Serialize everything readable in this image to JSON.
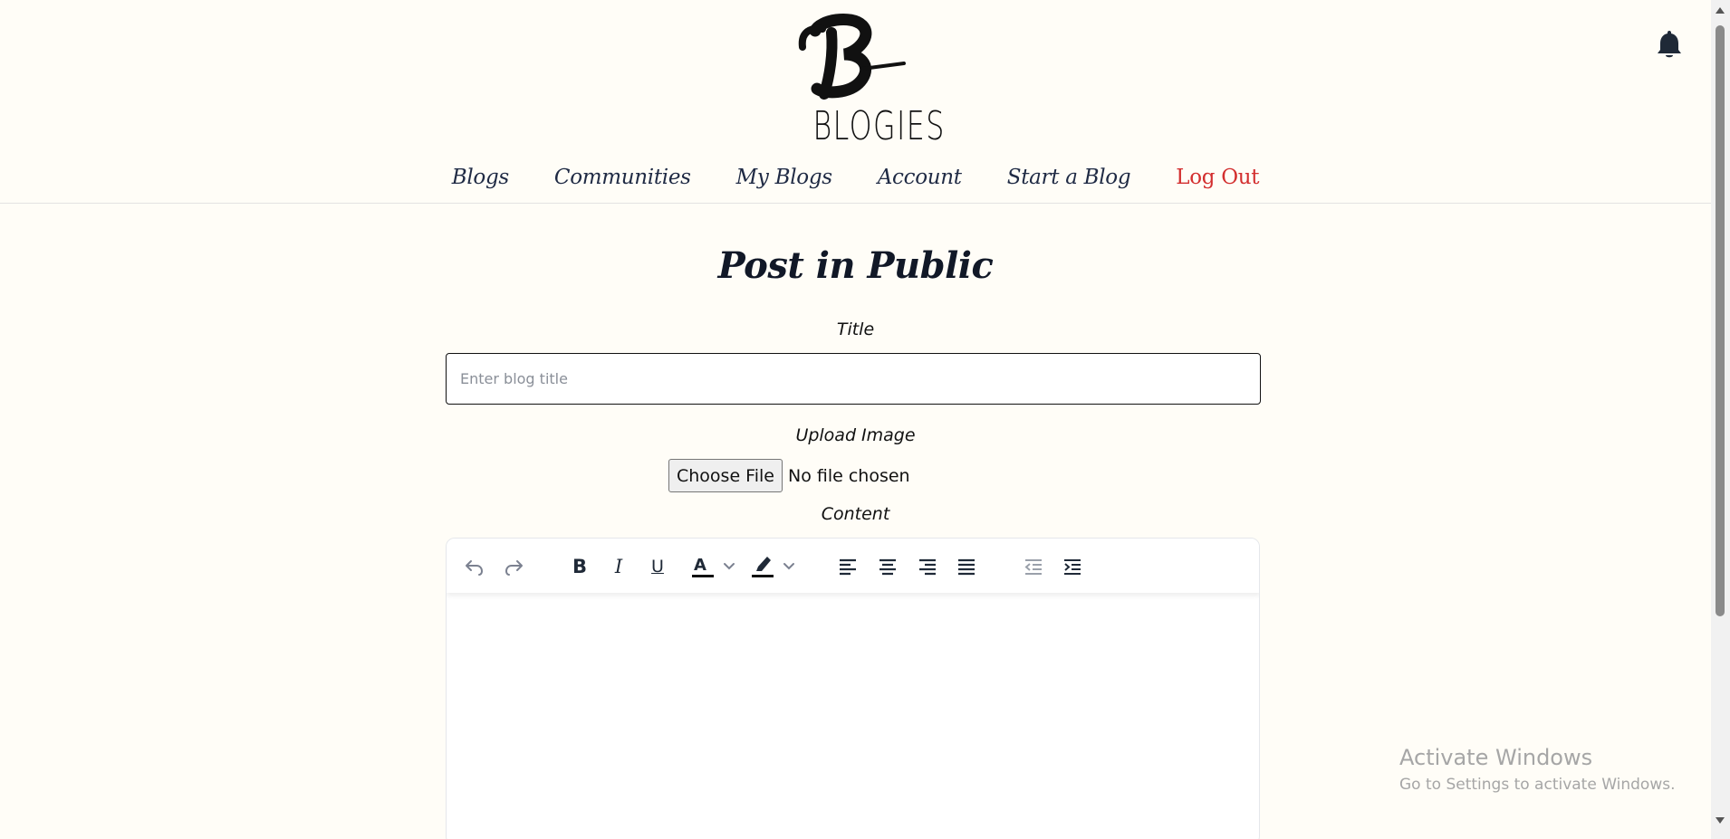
{
  "brand": {
    "name": "BLOGIES",
    "logo_letter": "B"
  },
  "nav": {
    "items": [
      {
        "label": "Blogs"
      },
      {
        "label": "Communities"
      },
      {
        "label": "My Blogs"
      },
      {
        "label": "Account"
      },
      {
        "label": "Start a Blog"
      }
    ],
    "logout_label": "Log Out"
  },
  "form": {
    "page_title": "Post in Public",
    "title_label": "Title",
    "title_placeholder": "Enter blog title",
    "title_value": "",
    "image_label": "Upload Image",
    "file_button_label": "Choose File",
    "file_status": "No file chosen",
    "content_label": "Content"
  },
  "editor": {
    "toolbar_icons": [
      "undo-icon",
      "redo-icon",
      "bold-icon",
      "italic-icon",
      "underline-icon",
      "text-color-icon",
      "highlight-icon",
      "align-left-icon",
      "align-center-icon",
      "align-right-icon",
      "align-justify-icon",
      "outdent-icon",
      "indent-icon"
    ],
    "bold_glyph": "B",
    "italic_glyph": "I",
    "underline_glyph": "U",
    "text_color_glyph": "A"
  },
  "watermark": {
    "title": "Activate Windows",
    "subtitle": "Go to Settings to activate Windows."
  },
  "colors": {
    "background": "#fffdf7",
    "nav_text": "#1f2a44",
    "logout": "#d32f2f",
    "title": "#111827"
  }
}
